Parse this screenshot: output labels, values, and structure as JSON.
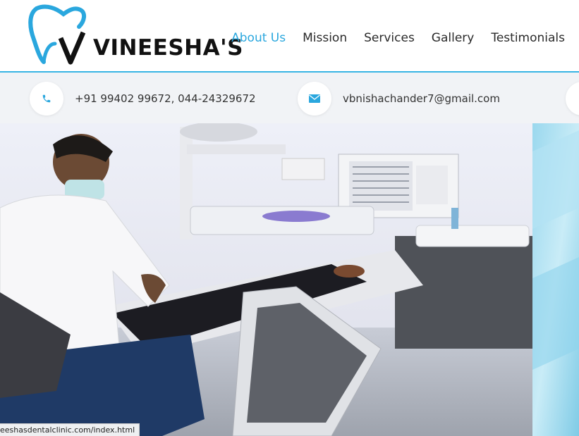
{
  "brand": {
    "name": "VINEESHA'S",
    "colors": {
      "accent": "#2aa7de",
      "dark": "#111111"
    }
  },
  "nav": {
    "items": [
      {
        "label": "About Us",
        "active": true
      },
      {
        "label": "Mission",
        "active": false
      },
      {
        "label": "Services",
        "active": false
      },
      {
        "label": "Gallery",
        "active": false
      },
      {
        "label": "Testimonials",
        "active": false
      }
    ]
  },
  "contact": {
    "phone": "+91 99402 99672, 044-24329672",
    "phone_icon": "phone-icon",
    "email": "vbnishachander7@gmail.com",
    "email_icon": "envelope-icon"
  },
  "hero": {
    "image": "dentist-treating-patient-photo"
  },
  "status_bar": {
    "url": "eeshasdentalclinic.com/index.html"
  }
}
